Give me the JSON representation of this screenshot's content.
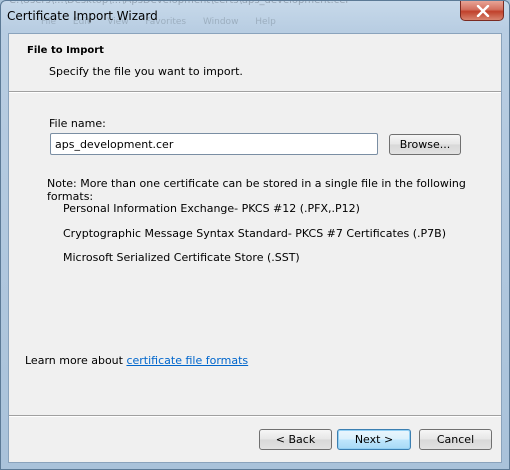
{
  "window": {
    "title": "Certificate Import Wizard",
    "background_bleed_text": "C:\\Users\\...\\Desktop\\...\\ApsDevelopment\\certs\\aps_development.cer",
    "background_bleed_menu": "File  Edit  View  Favorites  Window  Help"
  },
  "header": {
    "title": "File to Import",
    "subtitle": "Specify the file you want to import."
  },
  "file": {
    "label": "File name:",
    "value": "aps_development.cer",
    "browse_label": "Browse..."
  },
  "note": {
    "text": "Note:  More than one certificate can be stored in a single file in the following formats:",
    "formats": [
      "Personal Information Exchange- PKCS #12 (.PFX,.P12)",
      "Cryptographic Message Syntax Standard- PKCS #7 Certificates (.P7B)",
      "Microsoft Serialized Certificate Store (.SST)"
    ]
  },
  "learn_more": {
    "prefix": "Learn more about ",
    "link": "certificate file formats"
  },
  "buttons": {
    "back": "< Back",
    "next": "Next >",
    "cancel": "Cancel"
  },
  "colors": {
    "link": "#0066cc",
    "close_button": "#c0412b",
    "dialog_bg": "#f0f0f0",
    "window_frame": "#b8cde2"
  }
}
